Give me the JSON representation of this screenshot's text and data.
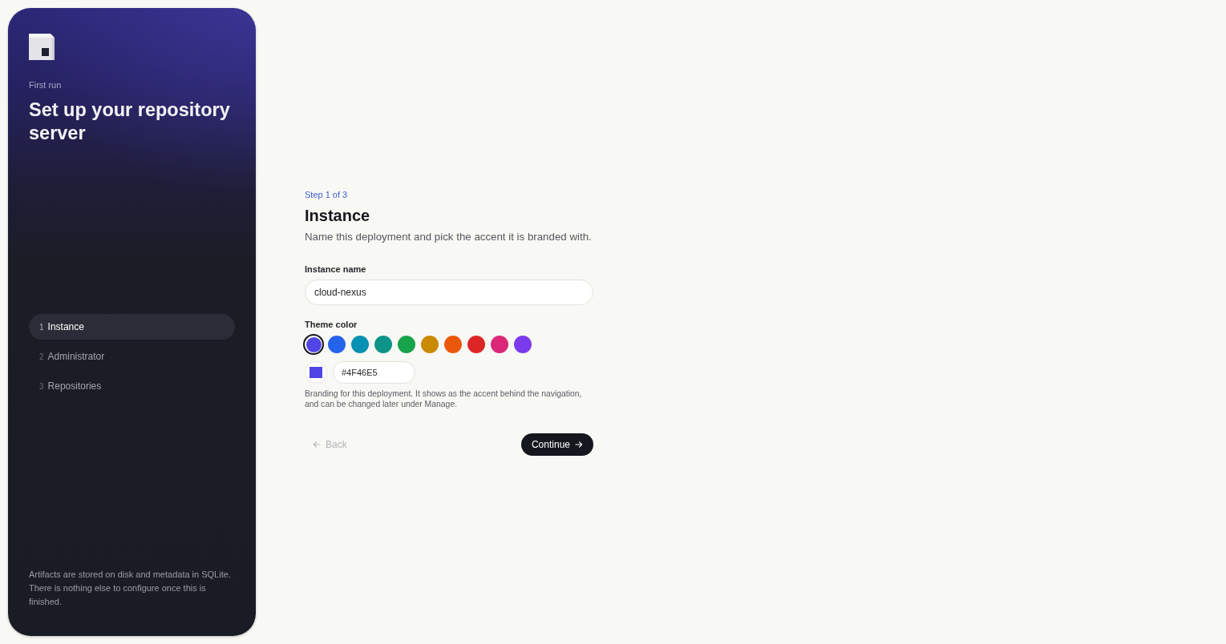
{
  "sidebar": {
    "eyebrow": "First run",
    "title": "Set up your repository server",
    "steps": [
      {
        "number": "1",
        "label": "Instance",
        "selected": true
      },
      {
        "number": "2",
        "label": "Administrator",
        "selected": false
      },
      {
        "number": "3",
        "label": "Repositories",
        "selected": false
      }
    ],
    "footnote": "Artifacts are stored on disk and metadata in SQLite. There is nothing else to configure once this is finished."
  },
  "form": {
    "step_indicator": "Step 1 of 3",
    "heading": "Instance",
    "description": "Name this deployment and pick the accent it is branded with.",
    "instance_name": {
      "label": "Instance name",
      "value": "cloud-nexus"
    },
    "theme_color": {
      "label": "Theme color",
      "swatches": [
        {
          "color": "#4f46e5",
          "selected": true
        },
        {
          "color": "#2563eb",
          "selected": false
        },
        {
          "color": "#0891b2",
          "selected": false
        },
        {
          "color": "#0d9488",
          "selected": false
        },
        {
          "color": "#16a34a",
          "selected": false
        },
        {
          "color": "#ca8a04",
          "selected": false
        },
        {
          "color": "#ea580c",
          "selected": false
        },
        {
          "color": "#dc2626",
          "selected": false
        },
        {
          "color": "#db2777",
          "selected": false
        },
        {
          "color": "#7c3aed",
          "selected": false
        }
      ],
      "hex_value": "#4F46E5",
      "help": "Branding for this deployment. It shows as the accent behind the navigation, and can be changed later under Manage."
    },
    "actions": {
      "back": {
        "label": "Back",
        "disabled": true
      },
      "continue": {
        "label": "Continue"
      }
    }
  }
}
